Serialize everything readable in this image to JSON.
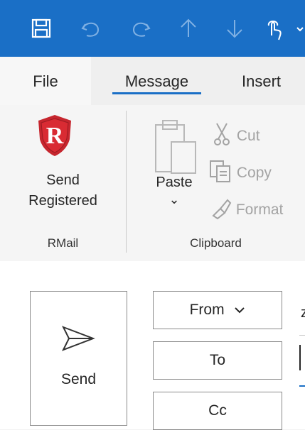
{
  "colors": {
    "accent": "#1a6fc6",
    "ribbon_bg": "#f5f5f5",
    "qat_bg": "#1a6fc6"
  },
  "qat": {
    "icons": [
      "save-icon",
      "undo-icon",
      "redo-icon",
      "up-arrow-icon",
      "down-arrow-icon",
      "touch-mode-icon",
      "customize-chevron-icon"
    ]
  },
  "tabs": [
    {
      "label": "File"
    },
    {
      "label": "Message",
      "selected": true
    },
    {
      "label": "Insert"
    }
  ],
  "ribbon": {
    "rmail": {
      "logo_letter": "R",
      "send_registered_line1": "Send",
      "send_registered_line2": "Registered",
      "group_label": "RMail"
    },
    "clipboard": {
      "paste_label": "Paste",
      "paste_chevron": "⌄",
      "cut_label": "Cut",
      "copy_label": "Copy",
      "format_label": "Format",
      "group_label": "Clipboard"
    }
  },
  "compose": {
    "send_label": "Send",
    "from_label": "From",
    "from_chevron": "⌄",
    "to_label": "To",
    "cc_label": "Cc",
    "from_value_clipped": "z"
  }
}
